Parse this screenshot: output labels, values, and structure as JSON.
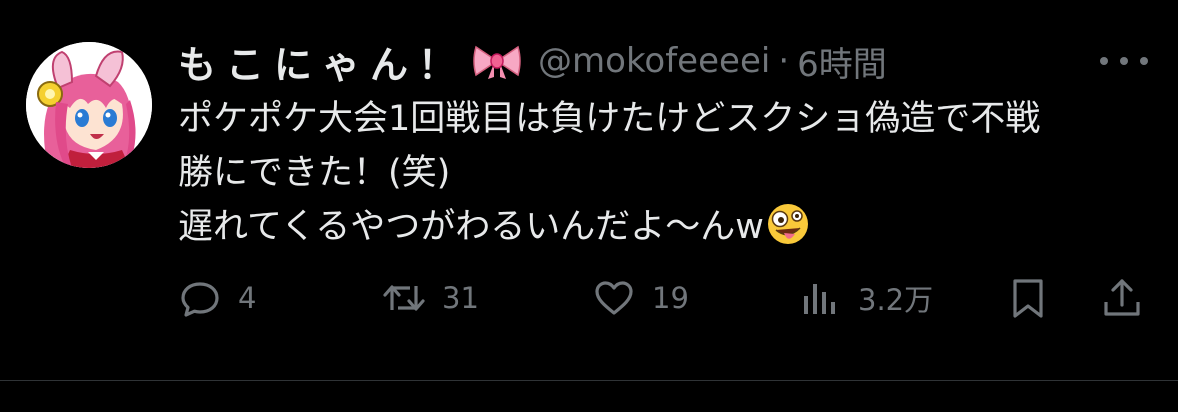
{
  "tweet": {
    "display_name": "もこにゃん！",
    "name_emoji": "ribbon-emoji",
    "handle": "@mokofeeeei",
    "separator": "·",
    "time": "6時間",
    "text_lines": [
      "ポケポケ大会1回戦目は負けたけどスクショ偽造で不戦",
      "勝にできた！(笑)",
      "遅れてくるやつがわるいんだよ〜んw"
    ],
    "trailing_emoji": "zany-face-emoji",
    "actions": {
      "reply_count": "4",
      "retweet_count": "31",
      "like_count": "19",
      "view_count": "3.2万"
    }
  },
  "colors": {
    "background": "#000000",
    "text": "#e7e9ea",
    "secondary": "#71767b",
    "divider": "#2f3336"
  }
}
